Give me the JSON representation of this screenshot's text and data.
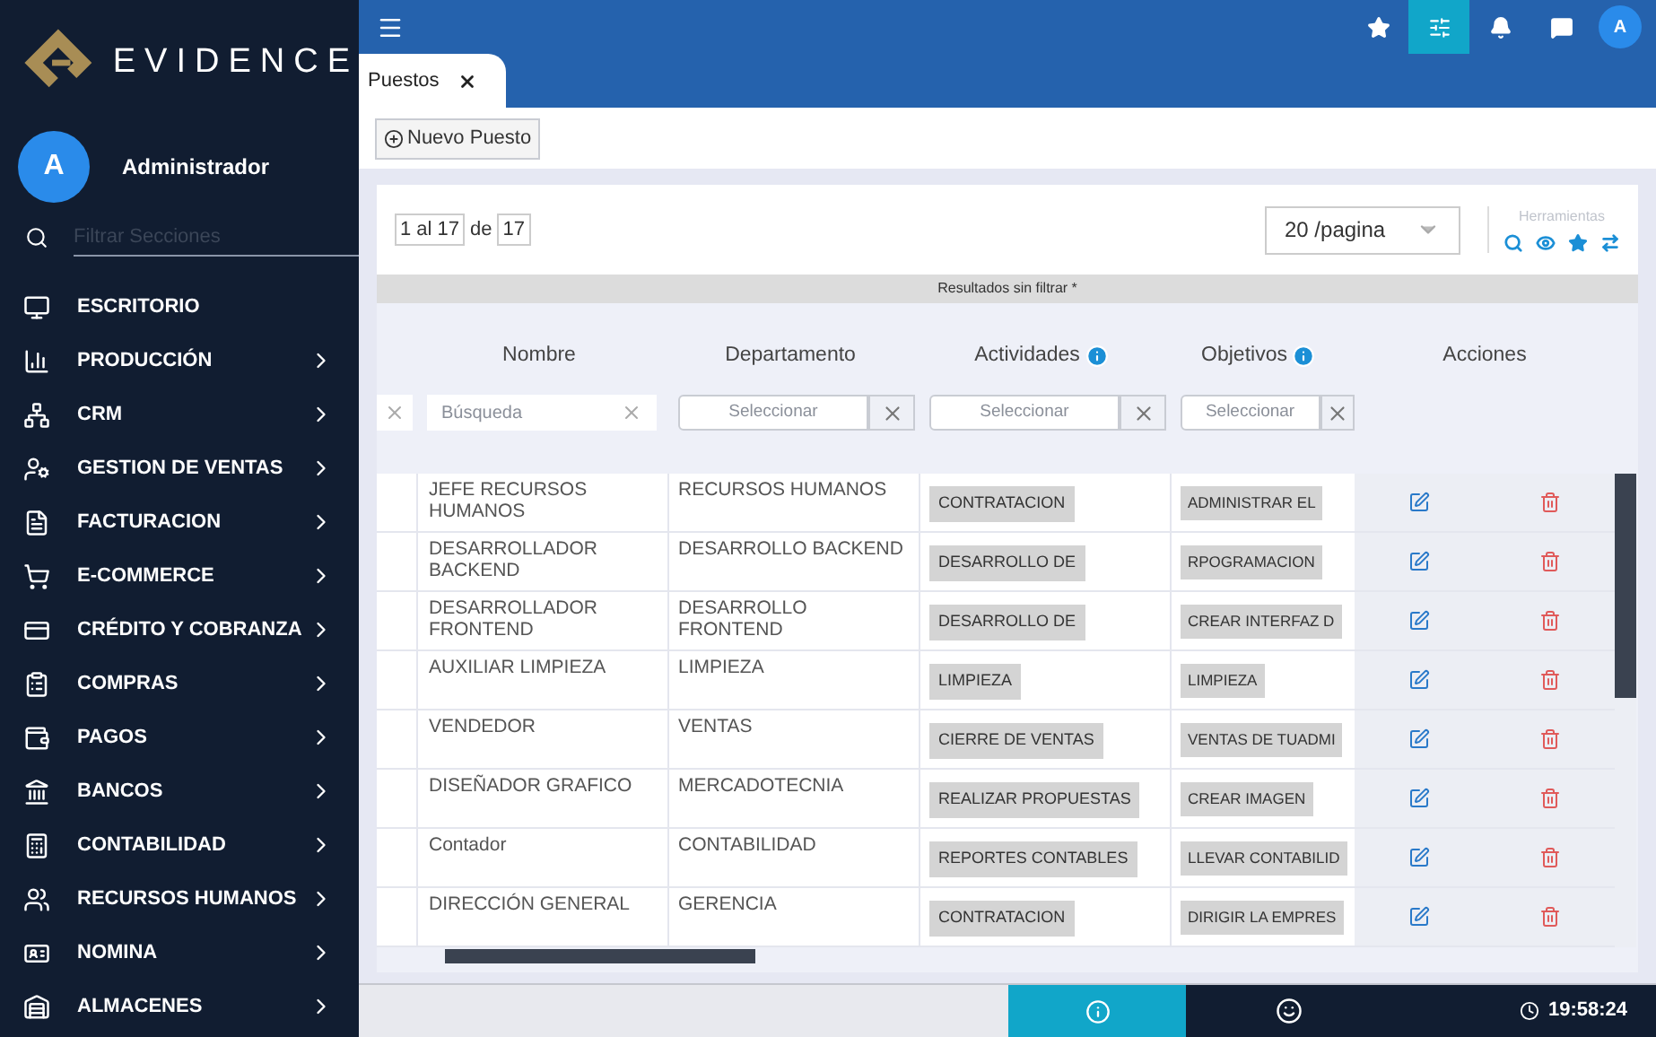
{
  "brand": {
    "name": "EVIDENCE"
  },
  "user": {
    "initial": "A",
    "name": "Administrador"
  },
  "sidebar_search": {
    "placeholder": "Filtrar Secciones"
  },
  "sidebar": {
    "items": [
      {
        "label": "ESCRITORIO",
        "has_submenu": false
      },
      {
        "label": "PRODUCCIÓN",
        "has_submenu": true
      },
      {
        "label": "CRM",
        "has_submenu": true
      },
      {
        "label": "GESTION DE VENTAS",
        "has_submenu": true
      },
      {
        "label": "FACTURACION",
        "has_submenu": true
      },
      {
        "label": "E-COMMERCE",
        "has_submenu": true
      },
      {
        "label": "CRÉDITO Y COBRANZA",
        "has_submenu": true
      },
      {
        "label": "COMPRAS",
        "has_submenu": true
      },
      {
        "label": "PAGOS",
        "has_submenu": true
      },
      {
        "label": "BANCOS",
        "has_submenu": true
      },
      {
        "label": "CONTABILIDAD",
        "has_submenu": true
      },
      {
        "label": "RECURSOS HUMANOS",
        "has_submenu": true
      },
      {
        "label": "NOMINA",
        "has_submenu": true
      },
      {
        "label": "ALMACENES",
        "has_submenu": true
      }
    ]
  },
  "topbar": {
    "avatar_initial": "A",
    "buttons": [
      {
        "selected": false
      },
      {
        "selected": true
      },
      {
        "selected": false
      },
      {
        "selected": false
      }
    ]
  },
  "tabs": [
    {
      "label": "Puestos",
      "selected": true
    }
  ],
  "toolbar": {
    "new_button": "Nuevo Puesto"
  },
  "pagination": {
    "range": "1 al 17",
    "of": "de",
    "total": "17",
    "page_size": "20 /pagina"
  },
  "tools": {
    "title": "Herramientas"
  },
  "results_banner": "Resultados sin filtrar *",
  "table": {
    "columns": [
      {
        "label": "Nombre",
        "has_info": false,
        "filter": {
          "kind": "search",
          "placeholder": "Búsqueda"
        }
      },
      {
        "label": "Departamento",
        "has_info": false,
        "filter": {
          "kind": "select",
          "placeholder": "Seleccionar"
        }
      },
      {
        "label": "Actividades",
        "has_info": true,
        "filter": {
          "kind": "select",
          "placeholder": "Seleccionar"
        }
      },
      {
        "label": "Objetivos",
        "has_info": true,
        "filter": {
          "kind": "select",
          "placeholder": "Seleccionar"
        }
      }
    ],
    "actions_label": "Acciones",
    "rows": [
      {
        "nombre": "JEFE RECURSOS HUMANOS",
        "departamento": "RECURSOS HUMANOS",
        "actividad": "CONTRATACION",
        "objetivo": "ADMINISTRAR EL"
      },
      {
        "nombre": "DESARROLLADOR BACKEND",
        "departamento": "DESARROLLO BACKEND",
        "actividad": "DESARROLLO DE",
        "objetivo": "RPOGRAMACION"
      },
      {
        "nombre": "DESARROLLADOR FRONTEND",
        "departamento": "DESARROLLO FRONTEND",
        "actividad": "DESARROLLO DE",
        "objetivo": "CREAR INTERFAZ D"
      },
      {
        "nombre": "AUXILIAR LIMPIEZA",
        "departamento": "LIMPIEZA",
        "actividad": "LIMPIEZA",
        "objetivo": "LIMPIEZA"
      },
      {
        "nombre": "VENDEDOR",
        "departamento": "VENTAS",
        "actividad": "CIERRE DE VENTAS",
        "objetivo": "VENTAS DE TUADMI"
      },
      {
        "nombre": "DISEÑADOR GRAFICO",
        "departamento": "MERCADOTECNIA",
        "actividad": "REALIZAR PROPUESTAS",
        "objetivo": "CREAR IMAGEN"
      },
      {
        "nombre": "Contador",
        "departamento": "CONTABILIDAD",
        "actividad": "REPORTES CONTABLES",
        "objetivo": "LLEVAR CONTABILID"
      },
      {
        "nombre": "DIRECCIÓN GENERAL",
        "departamento": "GERENCIA",
        "actividad": "CONTRATACION",
        "objetivo": "DIRIGIR LA EMPRES"
      }
    ]
  },
  "status_bar": {
    "time": "19:58:24"
  }
}
